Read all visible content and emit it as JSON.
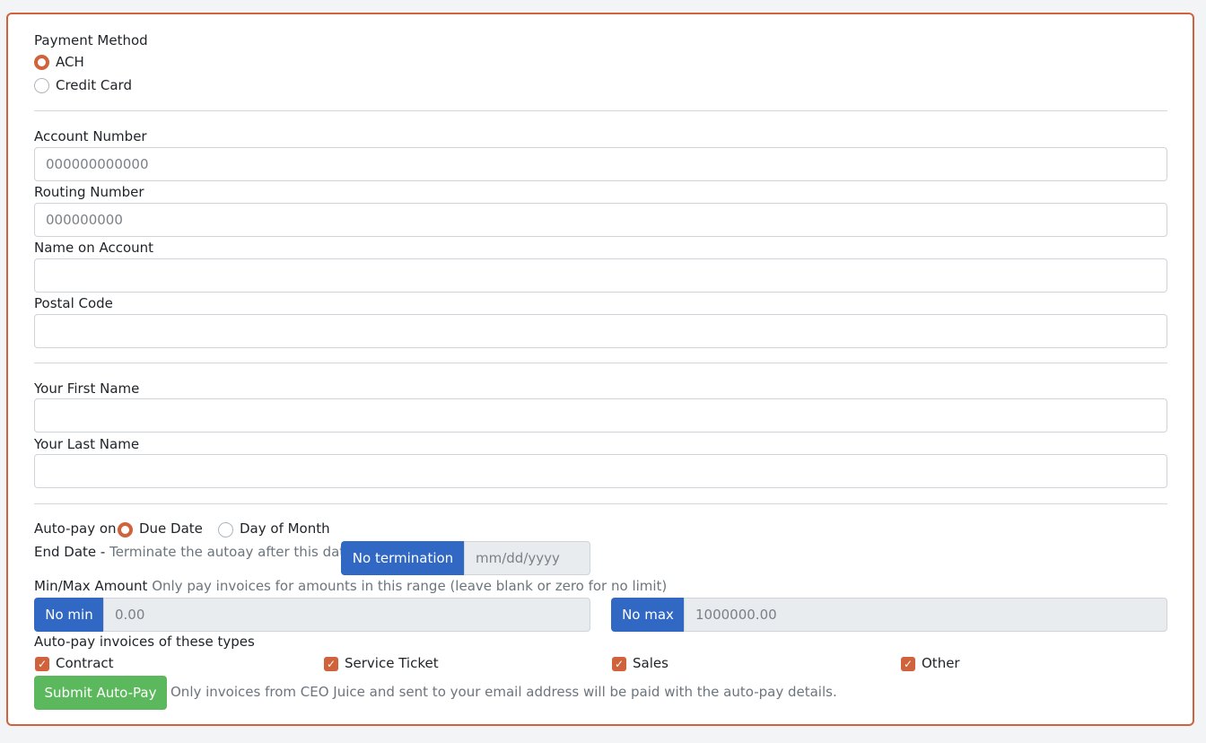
{
  "payment_method": {
    "label": "Payment Method",
    "options": [
      {
        "label": "ACH",
        "selected": true
      },
      {
        "label": "Credit Card",
        "selected": false
      }
    ]
  },
  "bank": {
    "account_number": {
      "label": "Account Number",
      "placeholder": "000000000000",
      "value": ""
    },
    "routing_number": {
      "label": "Routing Number",
      "placeholder": "000000000",
      "value": ""
    },
    "name_on_account": {
      "label": "Name on Account",
      "value": ""
    },
    "postal_code": {
      "label": "Postal Code",
      "value": ""
    }
  },
  "person": {
    "first_name": {
      "label": "Your First Name",
      "value": ""
    },
    "last_name": {
      "label": "Your Last Name",
      "value": ""
    }
  },
  "autopay": {
    "on_label": "Auto-pay on",
    "on_options": [
      {
        "label": "Due Date",
        "selected": true
      },
      {
        "label": "Day of Month",
        "selected": false
      }
    ],
    "end_date": {
      "label": "End Date -",
      "help": "Terminate the autoay after this date",
      "button": "No termination",
      "placeholder": "mm/dd/yyyy"
    },
    "amount": {
      "label": "Min/Max Amount",
      "help": "Only pay invoices for amounts in this range (leave blank or zero for no limit)",
      "min_button": "No min",
      "min_placeholder": "0.00",
      "max_button": "No max",
      "max_placeholder": "1000000.00"
    },
    "types": {
      "label": "Auto-pay invoices of these types",
      "items": [
        {
          "label": "Contract",
          "checked": true
        },
        {
          "label": "Service Ticket",
          "checked": true
        },
        {
          "label": "Sales",
          "checked": true
        },
        {
          "label": "Other",
          "checked": true
        }
      ]
    },
    "submit_label": "Submit Auto-Pay",
    "submit_note": "Only invoices from CEO Juice and sent to your email address will be paid with the auto-pay details."
  },
  "colors": {
    "accent": "#d0633b",
    "primary": "#3168c4",
    "success": "#5cb85c"
  }
}
